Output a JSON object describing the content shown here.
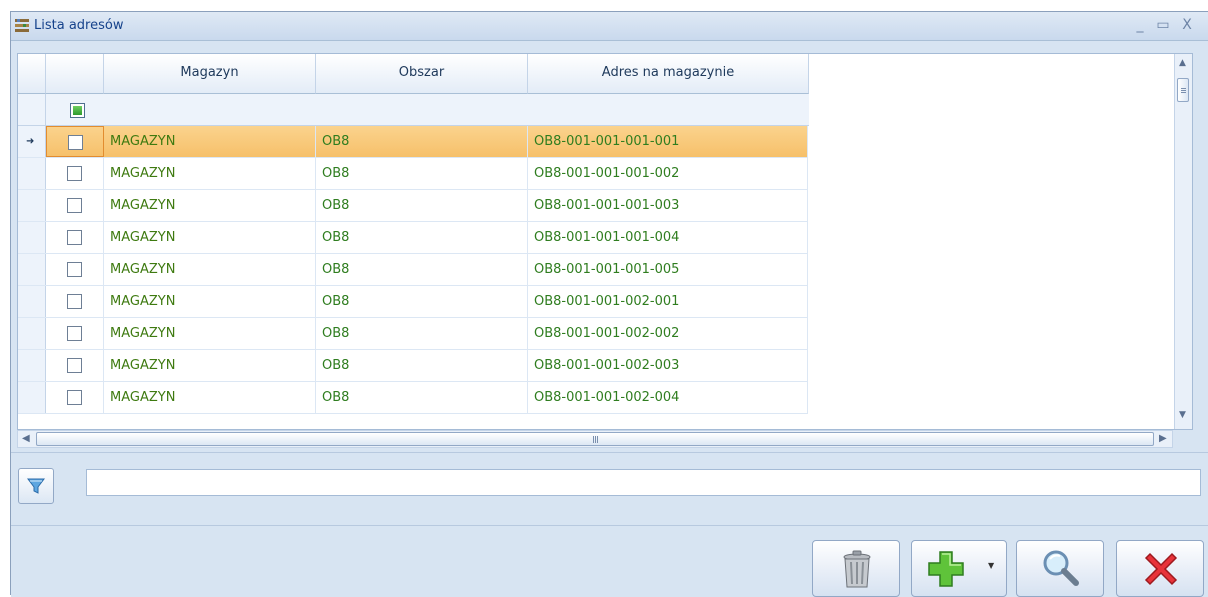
{
  "window": {
    "title": "Lista adresów"
  },
  "columns": {
    "magazyn": "Magazyn",
    "obszar": "Obszar",
    "adres": "Adres na magazynie"
  },
  "rows": [
    {
      "magazyn": "MAGAZYN",
      "obszar": "OB8",
      "adres": "OB8-001-001-001-001",
      "selected": true
    },
    {
      "magazyn": "MAGAZYN",
      "obszar": "OB8",
      "adres": "OB8-001-001-001-002"
    },
    {
      "magazyn": "MAGAZYN",
      "obszar": "OB8",
      "adres": "OB8-001-001-001-003"
    },
    {
      "magazyn": "MAGAZYN",
      "obszar": "OB8",
      "adres": "OB8-001-001-001-004"
    },
    {
      "magazyn": "MAGAZYN",
      "obszar": "OB8",
      "adres": "OB8-001-001-001-005"
    },
    {
      "magazyn": "MAGAZYN",
      "obszar": "OB8",
      "adres": "OB8-001-001-002-001"
    },
    {
      "magazyn": "MAGAZYN",
      "obszar": "OB8",
      "adres": "OB8-001-001-002-002"
    },
    {
      "magazyn": "MAGAZYN",
      "obszar": "OB8",
      "adres": "OB8-001-001-002-003"
    },
    {
      "magazyn": "MAGAZYN",
      "obszar": "OB8",
      "adres": "OB8-001-001-002-004"
    }
  ],
  "filter": {
    "value": ""
  },
  "icons": {
    "window": "shelves-icon",
    "filter": "funnel-icon",
    "delete": "trash-can-icon",
    "add": "green-plus-icon",
    "search": "magnifier-icon",
    "close": "red-x-icon"
  },
  "colors": {
    "selected_row": "#f6c06a",
    "cell_text": "#2f7d1f",
    "window_bg": "#d7e4f2"
  }
}
